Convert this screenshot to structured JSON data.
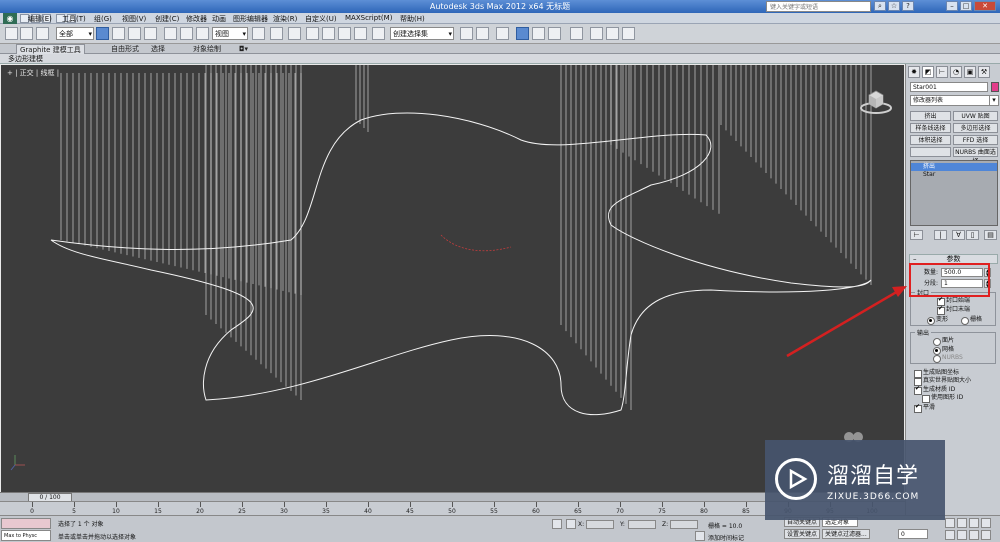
{
  "window": {
    "title": "Autodesk 3ds Max  2012 x64    无标题",
    "search_placeholder": "键入关键字或短语"
  },
  "menu": [
    "编辑(E)",
    "工具(T)",
    "组(G)",
    "视图(V)",
    "创建(C)",
    "修改器",
    "动画",
    "图形编辑器",
    "渲染(R)",
    "自定义(U)",
    "MAXScript(M)",
    "帮助(H)"
  ],
  "toolbar": {
    "selection_filter": "全部",
    "reference_coord": "视图",
    "named_selection": "创建选择集"
  },
  "ribbon": {
    "tabs": [
      "Graphite 建模工具",
      "自由形式",
      "选择",
      "对象绘制"
    ],
    "subtitle": "多边形建模"
  },
  "viewport": {
    "label": "+ | 正交 | 线框 |"
  },
  "command_panel": {
    "object_name": "Star001",
    "object_color": "#e23c8a",
    "modifier_list": "修改器列表",
    "modifier_buttons": [
      "挤出",
      "UVW 贴图",
      "样条线选择",
      "多边形选择",
      "体积选择",
      "FFD 选择",
      "",
      "NURBS 曲面选择"
    ],
    "stack": [
      "挤出",
      "Star"
    ],
    "rollout_title": "参数",
    "params": {
      "amount_label": "数量:",
      "amount_value": "500.0",
      "segments_label": "分段:",
      "segments_value": "1"
    },
    "capping": {
      "title": "封口",
      "cap_start": "封口始端",
      "cap_end": "封口末端",
      "morph": "变形",
      "grid": "栅格"
    },
    "output": {
      "title": "输出",
      "patch": "面片",
      "mesh": "网格",
      "nurbs": "NURBS"
    },
    "options": {
      "gen_map": "生成贴图坐标",
      "real_world": "真实世界贴图大小",
      "gen_mat": "生成材质 ID",
      "use_shape": "使用图形 ID",
      "smooth": "平滑"
    }
  },
  "timeline": {
    "frame": "0 / 100",
    "ticks": [
      "0",
      "5",
      "10",
      "15",
      "20",
      "25",
      "30",
      "35",
      "40",
      "45",
      "50",
      "55",
      "60",
      "65",
      "70",
      "75",
      "80",
      "85",
      "90",
      "95",
      "100"
    ]
  },
  "status": {
    "maxscript": "Max to Physc",
    "line1": "选择了 1 个 对象",
    "line2": "单击或单击并拖动以选择对象",
    "x_label": "X:",
    "y_label": "Y:",
    "z_label": "Z:",
    "grid": "栅格 = 10.0",
    "add_time_tag": "添加时间标记",
    "auto_key": "自动关键点",
    "set_key": "设置关键点",
    "selected": "选定对象",
    "key_filters": "关键点过滤器...",
    "frame_value": "0"
  },
  "watermark": {
    "name": "溜溜自学",
    "url": "ZIXUE.3D66.COM"
  }
}
